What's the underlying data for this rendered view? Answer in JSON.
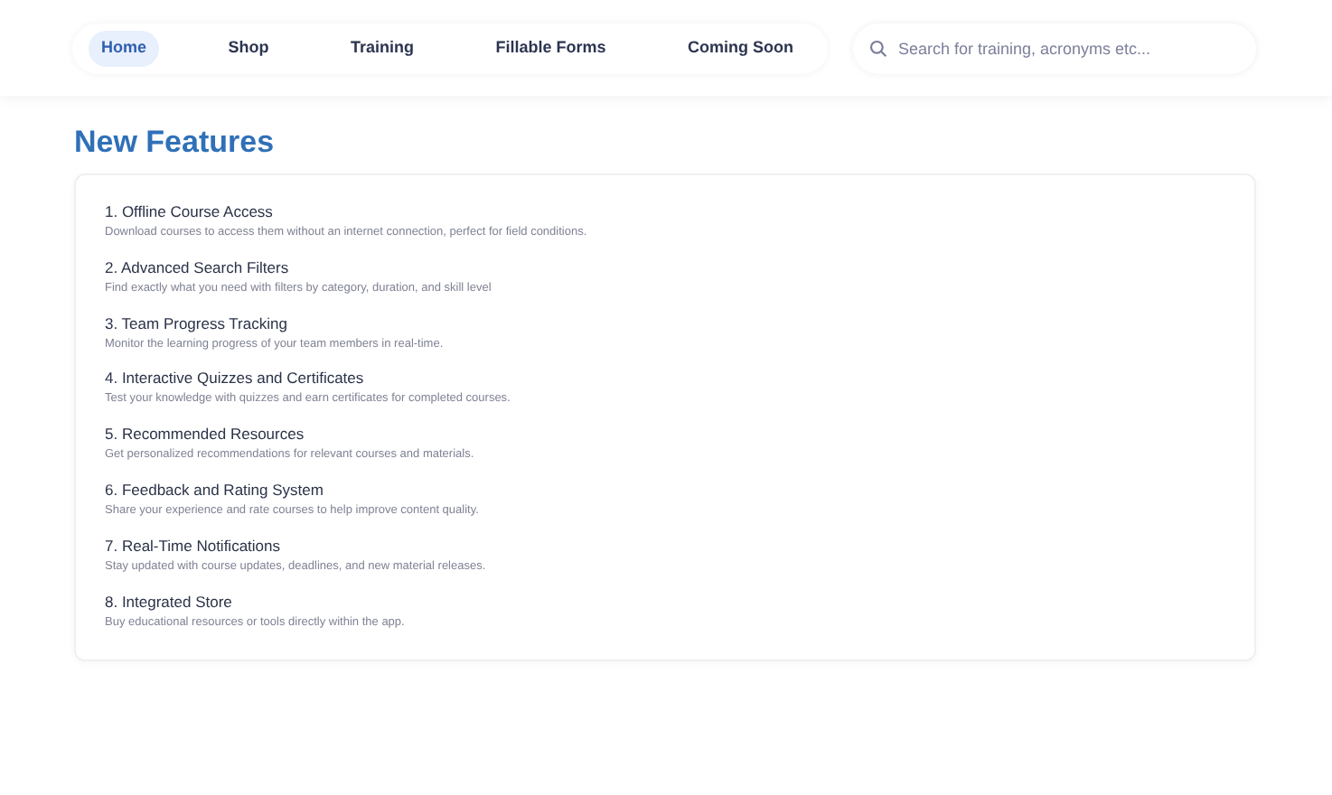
{
  "nav": {
    "tabs": [
      {
        "label": "Home",
        "selected": true
      },
      {
        "label": "Shop",
        "selected": false
      },
      {
        "label": "Training",
        "selected": false
      },
      {
        "label": "Fillable Forms",
        "selected": false
      },
      {
        "label": "Coming Soon",
        "selected": false
      }
    ],
    "search": {
      "placeholder": "Search for training, acronyms etc..."
    }
  },
  "heading": "New Features",
  "features": [
    {
      "title": "1. Offline Course Access",
      "description": "Download courses to access them without an internet connection, perfect for field conditions."
    },
    {
      "title": "2. Advanced Search Filters",
      "description": "Find exactly what you need with filters by category, duration, and skill level"
    },
    {
      "title": "3. Team Progress Tracking",
      "description": "Monitor the learning progress of your team members in real-time."
    },
    {
      "title": "4. Interactive Quizzes and Certificates",
      "description": "Test your knowledge with quizzes and earn certificates for completed courses."
    },
    {
      "title": "5. Recommended Resources",
      "description": "Get personalized recommendations for relevant courses and materials."
    },
    {
      "title": "6. Feedback and Rating System",
      "description": "Share your experience and rate courses to help improve content quality."
    },
    {
      "title": "7. Real-Time Notifications",
      "description": "Stay updated with course updates, deadlines, and new material releases."
    },
    {
      "title": "8. Integrated Store",
      "description": "Buy educational resources or tools directly within the app."
    }
  ]
}
